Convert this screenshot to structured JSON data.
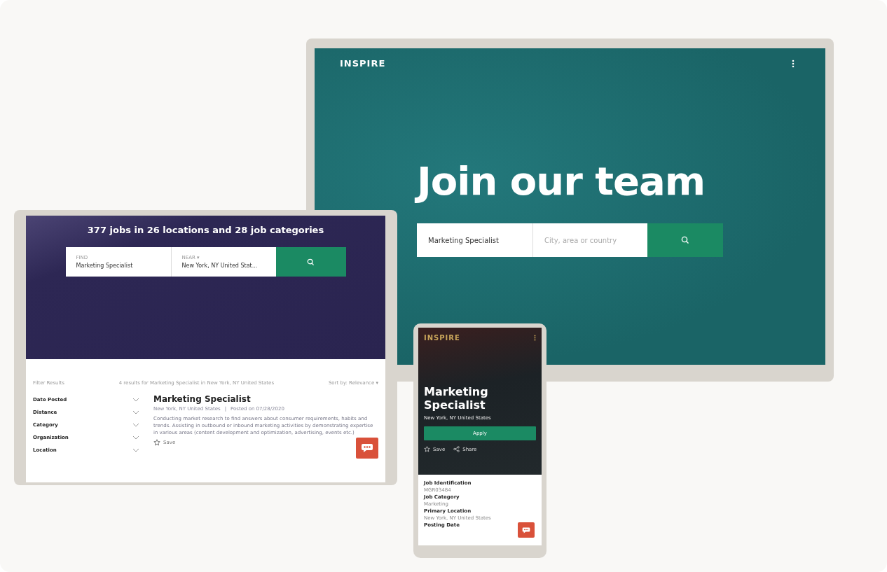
{
  "desktop": {
    "logo": "INSPIRE",
    "heading": "Join our team",
    "search": {
      "value": "Marketing Specialist",
      "placeholder": "City, area or country"
    }
  },
  "tablet": {
    "heading": "377 jobs in 26 locations and 28 job categories",
    "find": {
      "label": "FIND",
      "value": "Marketing Specialist"
    },
    "near": {
      "label": "NEAR ▾",
      "value": "New York, NY United Stat..."
    },
    "filter_heading": "Filter Results",
    "results_text": "4 results for Marketing Specialist in New York, NY United States",
    "sort": "Sort by: Relevance ▾",
    "filters": [
      {
        "label": "Date Posted",
        "expanded": false
      },
      {
        "label": "Distance",
        "expanded": false
      },
      {
        "label": "Category",
        "expanded": false
      },
      {
        "label": "Organization",
        "expanded": false
      },
      {
        "label": "Location",
        "expanded": false
      }
    ],
    "job": {
      "title": "Marketing Specialist",
      "location": "New York, NY United States",
      "separator": "|",
      "posted": "Posted on 07/28/2020",
      "description": "Conducting market research to find answers about consumer requirements, habits and trends. Assisting in outbound or inbound marketing activities by demonstrating expertise in various areas (content development and optimization, advertising, events etc.)",
      "save": "Save"
    }
  },
  "phone": {
    "logo": "INSPIRE",
    "title": "Marketing Specialist",
    "location": "New York, NY United States",
    "apply": "Apply",
    "save": "Save",
    "share": "Share",
    "details": [
      {
        "label": "Job Identification",
        "value": "MGR03484"
      },
      {
        "label": "Job Category",
        "value": "Marketing"
      },
      {
        "label": "Primary Location",
        "value": "New York, NY United States"
      },
      {
        "label": "Posting Date"
      }
    ]
  }
}
